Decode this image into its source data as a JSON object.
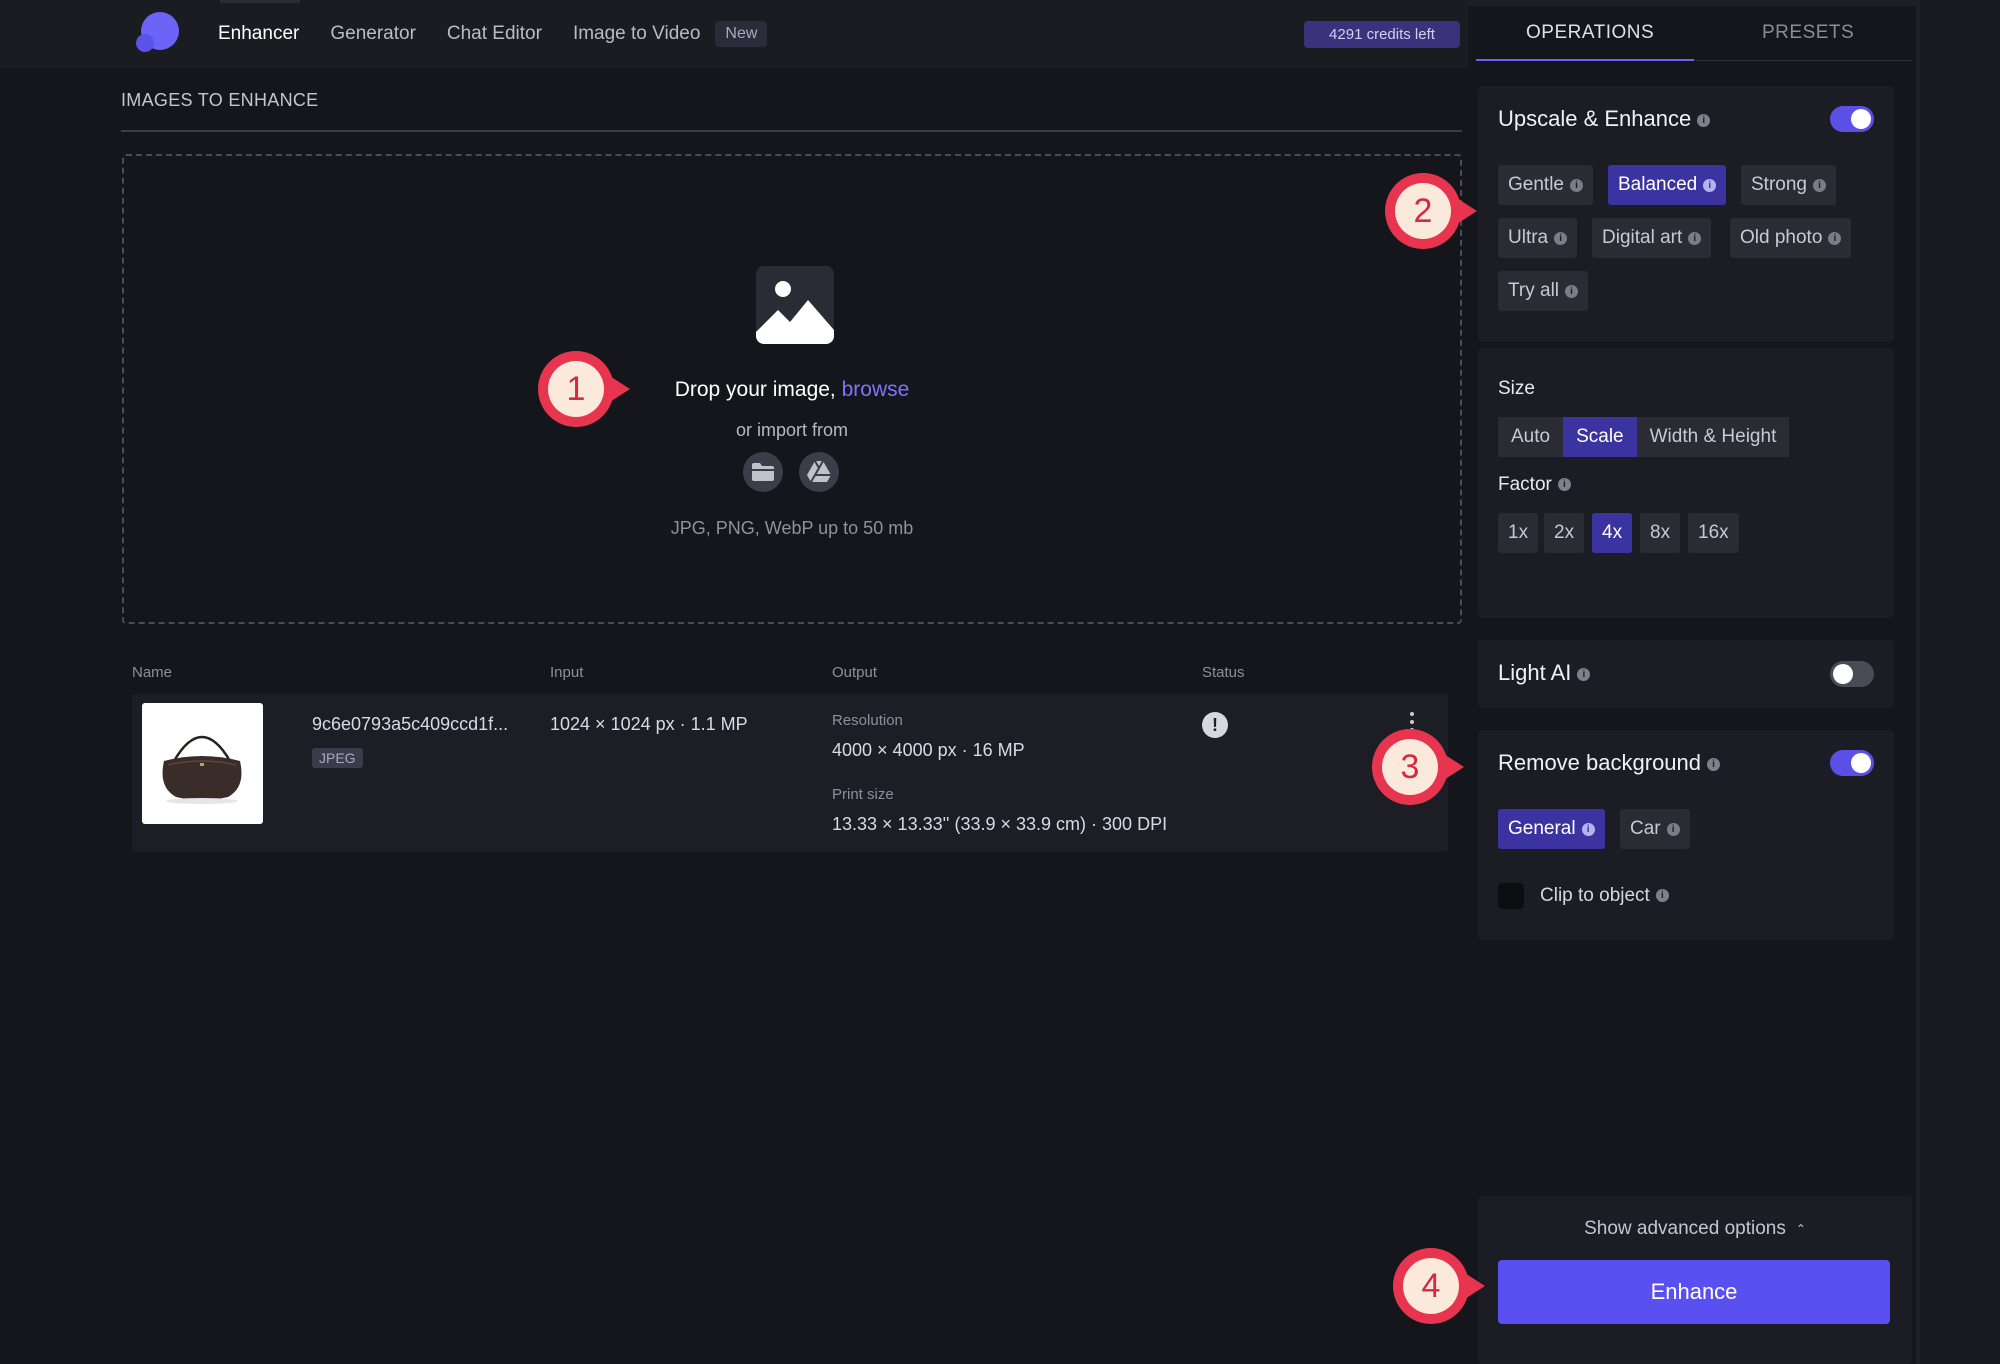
{
  "nav": {
    "items": [
      {
        "label": "Enhancer",
        "active": true
      },
      {
        "label": "Generator",
        "active": false
      },
      {
        "label": "Chat Editor",
        "active": false
      },
      {
        "label": "Image to Video",
        "active": false
      }
    ],
    "new_badge": "New",
    "credits": "4291 credits left"
  },
  "main": {
    "section_title": "IMAGES TO ENHANCE",
    "dropzone": {
      "drop_text": "Drop your image,",
      "browse_link": "browse",
      "import_text": "or import from",
      "import_sources": [
        "folder-icon",
        "google-drive-icon"
      ],
      "formats": "JPG, PNG, WebP up to 50 mb"
    },
    "table": {
      "headers": {
        "name": "Name",
        "input": "Input",
        "output": "Output",
        "status": "Status"
      },
      "rows": [
        {
          "file_name": "9c6e0793a5c409ccd1f...",
          "file_type": "JPEG",
          "input": "1024 × 1024 px · 1.1 MP",
          "resolution_label": "Resolution",
          "resolution": "4000 × 4000 px · 16 MP",
          "print_label": "Print size",
          "print_size": "13.33 × 13.33'' (33.9 × 33.9 cm) · 300 DPI",
          "status_icon": "alert-icon",
          "status_glyph": "!"
        }
      ]
    }
  },
  "markers": [
    "1",
    "2",
    "3",
    "4"
  ],
  "panel": {
    "tabs": [
      {
        "label": "OPERATIONS",
        "active": true
      },
      {
        "label": "PRESETS",
        "active": false
      }
    ],
    "upscale": {
      "title": "Upscale & Enhance",
      "enabled": true,
      "modes": [
        {
          "label": "Gentle",
          "selected": false
        },
        {
          "label": "Balanced",
          "selected": true
        },
        {
          "label": "Strong",
          "selected": false
        },
        {
          "label": "Ultra",
          "selected": false
        },
        {
          "label": "Digital art",
          "selected": false
        },
        {
          "label": "Old photo",
          "selected": false
        },
        {
          "label": "Try all",
          "selected": false
        }
      ],
      "size_label": "Size",
      "size_options": [
        {
          "label": "Auto",
          "selected": false
        },
        {
          "label": "Scale",
          "selected": true
        },
        {
          "label": "Width & Height",
          "selected": false
        }
      ],
      "factor_label": "Factor",
      "factors": [
        {
          "label": "1x",
          "selected": false
        },
        {
          "label": "2x",
          "selected": false
        },
        {
          "label": "4x",
          "selected": true
        },
        {
          "label": "8x",
          "selected": false
        },
        {
          "label": "16x",
          "selected": false
        }
      ]
    },
    "light_ai": {
      "title": "Light AI",
      "enabled": false
    },
    "remove_bg": {
      "title": "Remove background",
      "enabled": true,
      "modes": [
        {
          "label": "General",
          "selected": true
        },
        {
          "label": "Car",
          "selected": false
        }
      ],
      "clip_label": "Clip to object",
      "clip_checked": false
    },
    "advanced_label": "Show advanced options",
    "enhance_label": "Enhance"
  },
  "colors": {
    "accent": "#5a4ff0",
    "selected_chip": "#3b34a0",
    "marker": "#e8354f",
    "background": "#15161b"
  }
}
